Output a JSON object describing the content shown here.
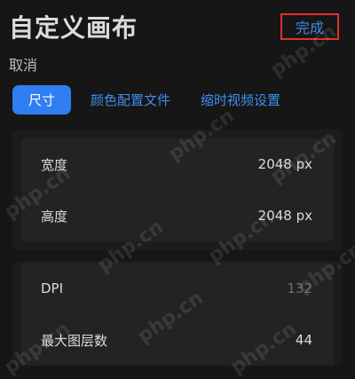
{
  "header": {
    "title": "自定义画布",
    "done_label": "完成",
    "cancel_label": "取消"
  },
  "tabs": [
    {
      "label": "尺寸",
      "active": true
    },
    {
      "label": "颜色配置文件",
      "active": false
    },
    {
      "label": "缩时视频设置",
      "active": false
    }
  ],
  "size_panel": {
    "width": {
      "label": "宽度",
      "value": "2048 px"
    },
    "height": {
      "label": "高度",
      "value": "2048 px"
    }
  },
  "info_panel": {
    "dpi": {
      "label": "DPI",
      "value": "132"
    },
    "max_layers": {
      "label": "最大图层数",
      "value": "44"
    }
  },
  "watermark": "php.cn",
  "colors": {
    "accent": "#2f7ef3",
    "link": "#3e8ef0",
    "highlight_box": "#e0302c",
    "background": "#161616"
  }
}
